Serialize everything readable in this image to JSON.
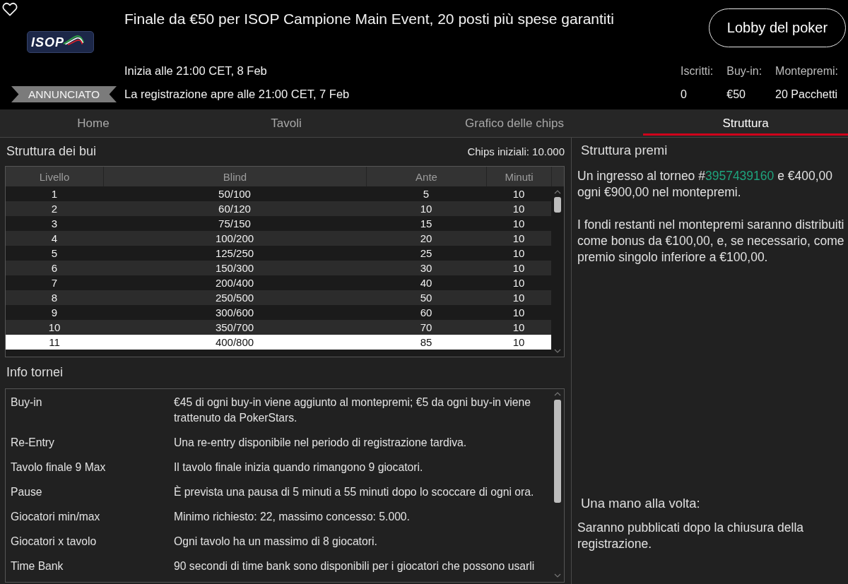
{
  "header": {
    "favorite": false,
    "logo_text": "ISOP",
    "title": "Finale da €50 per ISOP Campione Main Event, 20 posti più spese garantiti",
    "lobby_button": "Lobby del poker",
    "start_time": "Inizia alle 21:00 CET, 8 Feb",
    "status_badge": "ANNUNCIATO",
    "registration_time": "La registrazione apre alle 21:00 CET, 7 Feb",
    "stats": [
      {
        "label": "Iscritti:",
        "value": "0"
      },
      {
        "label": "Buy-in:",
        "value": "€50"
      },
      {
        "label": "Montepremi:",
        "value": "20 Pacchetti"
      }
    ]
  },
  "tabs": [
    {
      "label": "Home",
      "selected": false
    },
    {
      "label": "Tavoli",
      "selected": false
    },
    {
      "label": "Grafico delle chips",
      "selected": false
    },
    {
      "label": "Struttura",
      "selected": true
    }
  ],
  "blind_structure": {
    "title": "Struttura dei bui",
    "starting_chips": "Chips iniziali: 10.000",
    "columns": [
      "Livello",
      "Blind",
      "Ante",
      "Minuti"
    ],
    "rows": [
      {
        "cells": [
          "1",
          "50/100",
          "5",
          "10"
        ],
        "selected": false
      },
      {
        "cells": [
          "2",
          "60/120",
          "10",
          "10"
        ],
        "selected": false
      },
      {
        "cells": [
          "3",
          "75/150",
          "15",
          "10"
        ],
        "selected": false
      },
      {
        "cells": [
          "4",
          "100/200",
          "20",
          "10"
        ],
        "selected": false
      },
      {
        "cells": [
          "5",
          "125/250",
          "25",
          "10"
        ],
        "selected": false
      },
      {
        "cells": [
          "6",
          "150/300",
          "30",
          "10"
        ],
        "selected": false
      },
      {
        "cells": [
          "7",
          "200/400",
          "40",
          "10"
        ],
        "selected": false
      },
      {
        "cells": [
          "8",
          "250/500",
          "50",
          "10"
        ],
        "selected": false
      },
      {
        "cells": [
          "9",
          "300/600",
          "60",
          "10"
        ],
        "selected": false
      },
      {
        "cells": [
          "10",
          "350/700",
          "70",
          "10"
        ],
        "selected": false
      },
      {
        "cells": [
          "11",
          "400/800",
          "85",
          "10"
        ],
        "selected": true
      }
    ]
  },
  "tournament_info": {
    "title": "Info tornei",
    "rows": [
      {
        "label": "Buy-in",
        "value": "€45 di ogni buy-in viene aggiunto al montepremi; €5 da ogni buy-in viene trattenuto da PokerStars."
      },
      {
        "label": "Re-Entry",
        "value": "Una re-entry disponibile nel periodo di registrazione tardiva."
      },
      {
        "label": "Tavolo finale 9 Max",
        "value": "Il tavolo finale inizia quando rimangono 9 giocatori."
      },
      {
        "label": "Pause",
        "value": "È prevista una pausa di 5 minuti a 55 minuti dopo lo scoccare di ogni ora."
      },
      {
        "label": "Giocatori min/max",
        "value": "Minimo richiesto: 22, massimo concesso: 5.000."
      },
      {
        "label": "Giocatori x tavolo",
        "value": "Ogni tavolo ha un massimo di 8 giocatori."
      },
      {
        "label": "Time Bank",
        "value": "90 secondi di time bank sono disponibili per i giocatori che possono usarli"
      }
    ]
  },
  "prize_structure": {
    "title": "Struttura premi",
    "paragraphs": [
      {
        "kind": "with_link",
        "text_before": "Un ingresso al torneo #",
        "link": "3957439160",
        "text_after": " e €400,00 ogni €900,00 nel montepremi."
      },
      {
        "kind": "plain",
        "text": "I fondi restanti nel montepremi saranno distribuiti come bonus da €100,00, e, se necessario, come premio singolo inferiore a €100,00."
      }
    ]
  },
  "one_hand": {
    "title": "Una mano alla volta:",
    "text": "Saranno pubblicati dopo la chiusura della registrazione."
  }
}
